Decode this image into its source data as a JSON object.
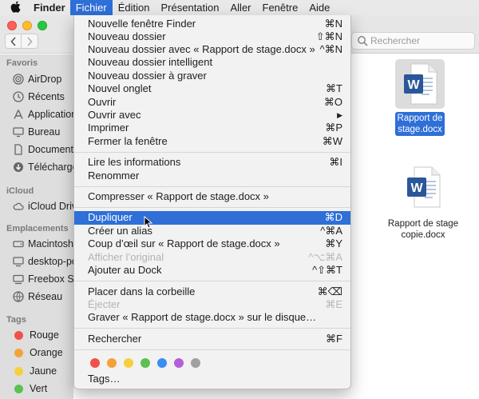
{
  "menubar": {
    "apple": "",
    "app_name": "Finder",
    "items": [
      "Fichier",
      "Édition",
      "Présentation",
      "Aller",
      "Fenêtre",
      "Aide"
    ],
    "active_index": 0
  },
  "search": {
    "placeholder": "Rechercher"
  },
  "sidebar": {
    "sections": [
      {
        "title": "Favoris",
        "items": [
          {
            "label": "AirDrop",
            "icon": "airdrop-icon"
          },
          {
            "label": "Récents",
            "icon": "recents-icon"
          },
          {
            "label": "Applications",
            "icon": "applications-icon"
          },
          {
            "label": "Bureau",
            "icon": "desktop-icon"
          },
          {
            "label": "Documents",
            "icon": "documents-icon"
          },
          {
            "label": "Téléchargements",
            "icon": "downloads-icon"
          }
        ]
      },
      {
        "title": "iCloud",
        "items": [
          {
            "label": "iCloud Drive",
            "icon": "cloud-icon"
          }
        ]
      },
      {
        "title": "Emplacements",
        "items": [
          {
            "label": "Macintosh HD",
            "icon": "disk-icon"
          },
          {
            "label": "desktop-pc",
            "icon": "computer-icon"
          },
          {
            "label": "Freebox Server",
            "icon": "display-icon"
          },
          {
            "label": "Réseau",
            "icon": "network-icon"
          }
        ]
      },
      {
        "title": "Tags",
        "items": [
          {
            "label": "Rouge",
            "color": "#f0524b"
          },
          {
            "label": "Orange",
            "color": "#f5a13a"
          },
          {
            "label": "Jaune",
            "color": "#f6cf3d"
          },
          {
            "label": "Vert",
            "color": "#5ac151"
          }
        ]
      }
    ]
  },
  "files": [
    {
      "name_line1": "Rapport de",
      "name_line2": "stage.docx",
      "selected": true,
      "icon": "word-document-icon"
    },
    {
      "name_line1": "Rapport de stage",
      "name_line2": "copie.docx",
      "selected": false,
      "icon": "word-document-icon"
    }
  ],
  "menu": {
    "groups": [
      [
        {
          "label": "Nouvelle fenêtre Finder",
          "shortcut": "⌘N"
        },
        {
          "label": "Nouveau dossier",
          "shortcut": "⇧⌘N"
        },
        {
          "label": "Nouveau dossier avec « Rapport de stage.docx »",
          "shortcut": "^⌘N"
        },
        {
          "label": "Nouveau dossier intelligent",
          "shortcut": ""
        },
        {
          "label": "Nouveau dossier à graver",
          "shortcut": ""
        },
        {
          "label": "Nouvel onglet",
          "shortcut": "⌘T"
        },
        {
          "label": "Ouvrir",
          "shortcut": "⌘O"
        },
        {
          "label": "Ouvrir avec",
          "shortcut": "▶"
        },
        {
          "label": "Imprimer",
          "shortcut": "⌘P"
        },
        {
          "label": "Fermer la fenêtre",
          "shortcut": "⌘W"
        }
      ],
      [
        {
          "label": "Lire les informations",
          "shortcut": "⌘I"
        },
        {
          "label": "Renommer",
          "shortcut": ""
        }
      ],
      [
        {
          "label": "Compresser « Rapport de stage.docx »",
          "shortcut": ""
        }
      ],
      [
        {
          "label": "Dupliquer",
          "shortcut": "⌘D",
          "highlighted": true
        },
        {
          "label": "Créer un alias",
          "shortcut": "^⌘A"
        },
        {
          "label": "Coup d’œil sur « Rapport de stage.docx »",
          "shortcut": "⌘Y"
        },
        {
          "label": "Afficher l’original",
          "shortcut": "^⌥⌘A",
          "disabled": true
        },
        {
          "label": "Ajouter au Dock",
          "shortcut": "^⇧⌘T"
        }
      ],
      [
        {
          "label": "Placer dans la corbeille",
          "shortcut": "⌘⌫"
        },
        {
          "label": "Éjecter",
          "shortcut": "⌘E",
          "disabled": true
        },
        {
          "label": "Graver « Rapport de stage.docx » sur le disque…",
          "shortcut": ""
        }
      ],
      [
        {
          "label": "Rechercher",
          "shortcut": "⌘F"
        }
      ]
    ],
    "tag_colors": [
      "#f0524b",
      "#f5a13a",
      "#f6cf3d",
      "#5ac151",
      "#3b8cf5",
      "#b560d6",
      "#a0a0a0"
    ],
    "tags_label": "Tags…"
  }
}
